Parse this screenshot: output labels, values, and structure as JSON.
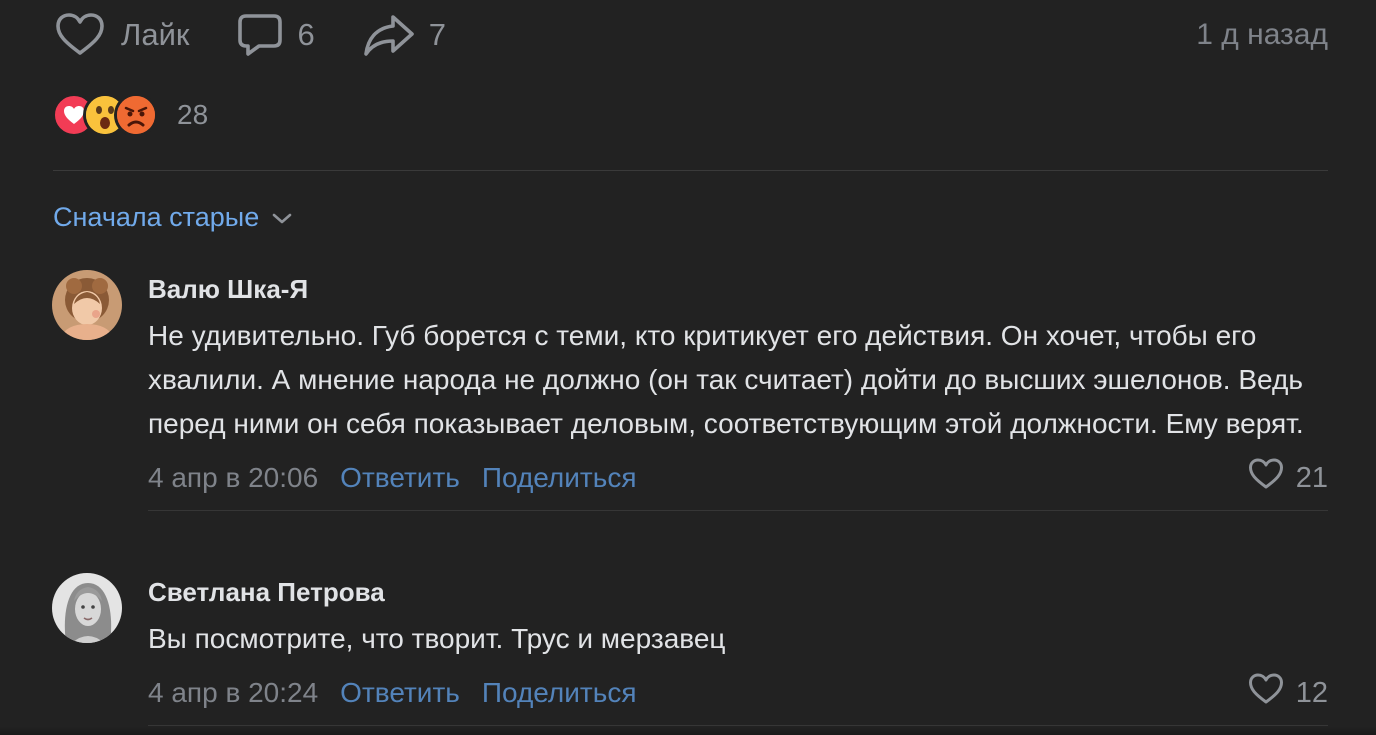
{
  "post_actions": {
    "like_label": "Лайк",
    "comments_count": "6",
    "shares_count": "7",
    "time_ago": "1 д назад"
  },
  "reactions": {
    "icons": [
      "heart-reaction-icon",
      "wow-reaction-icon",
      "angry-reaction-icon"
    ],
    "count": "28"
  },
  "sort": {
    "label": "Сначала старые"
  },
  "comments": [
    {
      "author": "Валю Шка-Я",
      "text": "Не удивительно. Губ борется с теми, кто критикует его действия. Он хочет, чтобы его хвалили. А мнение народа не должно (он так считает) дойти до высших эшелонов. Ведь перед ними он себя показывает деловым, соответствующим этой должности. Ему верят.",
      "date": "4 апр в 20:06",
      "reply_label": "Ответить",
      "share_label": "Поделиться",
      "likes": "21"
    },
    {
      "author": "Светлана Петрова",
      "text": "Вы посмотрите, что творит. Трус и мерзавец",
      "date": "4 апр в 20:24",
      "reply_label": "Ответить",
      "share_label": "Поделиться",
      "likes": "12"
    }
  ],
  "colors": {
    "background": "#222222",
    "link": "#71aaeb",
    "action_link": "#5383ba",
    "muted": "#8f9399",
    "text": "#e1e3e6"
  }
}
